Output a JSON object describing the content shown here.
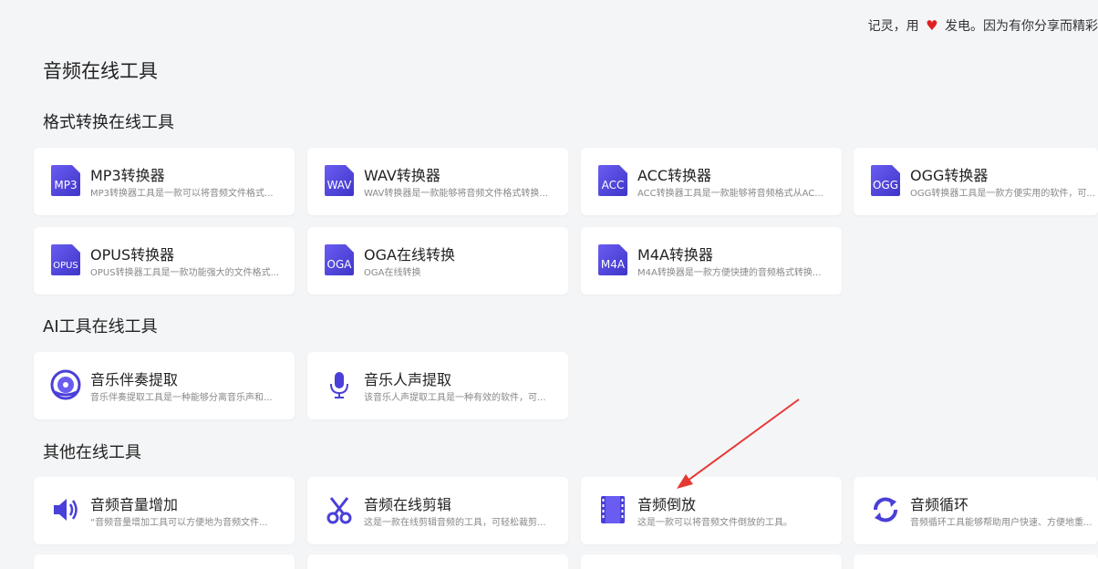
{
  "topbar": {
    "text_before": "记灵，用",
    "text_after": "发电。因为有你分享而精彩"
  },
  "page_title": "音频在线工具",
  "sections": [
    {
      "title": "格式转换在线工具",
      "items": [
        {
          "icon_text": "MP3",
          "name": "MP3转换器",
          "desc": "MP3转换器工具是一款可以将音频文件格式..."
        },
        {
          "icon_text": "WAV",
          "name": "WAV转换器",
          "desc": "WAV转换器是一款能够将音频文件格式转换..."
        },
        {
          "icon_text": "ACC",
          "name": "ACC转换器",
          "desc": "ACC转换器工具是一款能够将音频格式从AC..."
        },
        {
          "icon_text": "OGG",
          "name": "OGG转换器",
          "desc": "OGG转换器工具是一款方便实用的软件，可..."
        },
        {
          "icon_text": "OPUS",
          "name": "OPUS转换器",
          "desc": "OPUS转换器工具是一款功能强大的文件格式..."
        },
        {
          "icon_text": "OGA",
          "name": "OGA在线转换",
          "desc": "OGA在线转换"
        },
        {
          "icon_text": "M4A",
          "name": "M4A转换器",
          "desc": "M4A转换器是一款方便快捷的音频格式转换..."
        }
      ]
    },
    {
      "title": "AI工具在线工具",
      "items": [
        {
          "icon": "accompaniment-icon",
          "name": "音乐伴奏提取",
          "desc": "音乐伴奏提取工具是一种能够分离音乐声和..."
        },
        {
          "icon": "microphone-icon",
          "name": "音乐人声提取",
          "desc": "该音乐人声提取工具是一种有效的软件，可..."
        }
      ]
    },
    {
      "title": "其他在线工具",
      "items": [
        {
          "icon": "volume-icon",
          "name": "音频音量增加",
          "desc": "“音频音量增加工具可以方便地为音频文件..."
        },
        {
          "icon": "scissors-icon",
          "name": "音频在线剪辑",
          "desc": "这是一款在线剪辑音频的工具，可轻松裁剪..."
        },
        {
          "icon": "film-reverse-icon",
          "name": "音频倒放",
          "desc": "这是一款可以将音频文件倒放的工具。"
        },
        {
          "icon": "loop-icon",
          "name": "音频循环",
          "desc": "音频循环工具能够帮助用户快速、方便地重..."
        }
      ]
    }
  ],
  "colors": {
    "accent": "#4a3fd8",
    "arrow": "#e53935",
    "heart": "#e02020",
    "background": "#f4f5f7"
  }
}
